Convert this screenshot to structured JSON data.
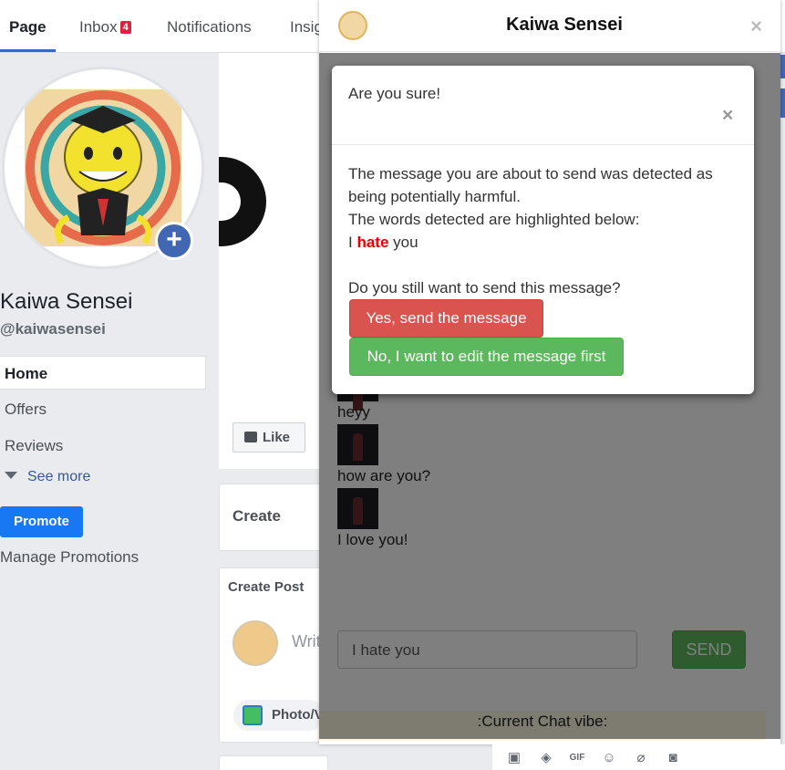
{
  "tabs": {
    "page": "Page",
    "inbox": "Inbox",
    "inbox_badge": "4",
    "notifications": "Notifications",
    "insights": "Insig"
  },
  "sidebar": {
    "page_name": "Kaiwa Sensei",
    "handle": "@kaiwasensei",
    "items": [
      "Home",
      "Offers",
      "Reviews"
    ],
    "see_more": "See more",
    "promote": "Promote",
    "manage_promotions": "Manage Promotions"
  },
  "main": {
    "like": "Like",
    "create": "Create",
    "create_post": "Create Post",
    "write_placeholder": "Writ",
    "photo_button": "Photo/V"
  },
  "chat": {
    "title": "Kaiwa Sensei",
    "close": "×",
    "messages": [
      "heyy",
      "how are you?",
      "I love you!"
    ],
    "input_value": "I hate you",
    "send": "SEND",
    "vibe": ":Current Chat vibe:"
  },
  "modal": {
    "title": "Are you sure!",
    "close": "×",
    "line1": "The message you are about to send was detected as being potentially harmful.",
    "line2": "The words detected are highlighted below:",
    "msg_before": "I",
    "msg_flagged": "hate",
    "msg_after": "you",
    "question": "Do you still want to send this message?",
    "yes": "Yes, send the message",
    "no": "No, I want to edit the message first"
  },
  "icons": [
    "photo-icon",
    "sticker-icon",
    "gif-icon",
    "emoji-icon",
    "attachment-icon",
    "camera-icon"
  ],
  "colors": {
    "facebook_blue": "#4267b2",
    "danger": "#d9534f",
    "success": "#5cb85c",
    "flagged_word": "#e00000",
    "vibe_bg": "#fcf8e3"
  }
}
